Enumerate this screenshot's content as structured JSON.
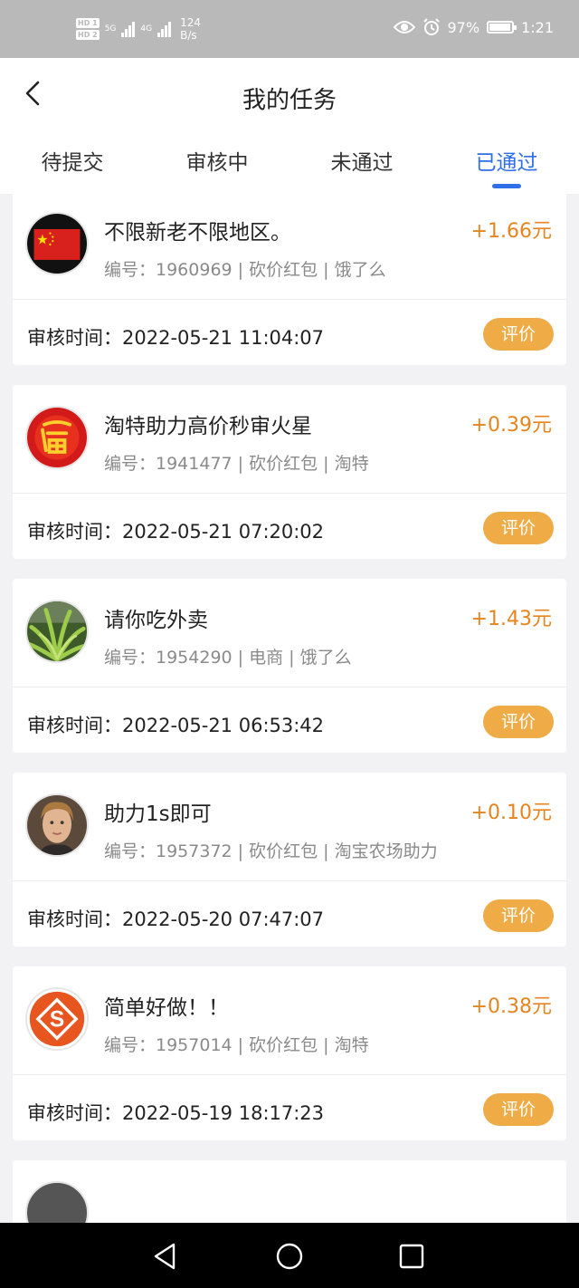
{
  "status_bar": {
    "hd1": "HD 1",
    "hd2": "HD 2",
    "network": "5G",
    "network2": "4G",
    "speed_value": "124",
    "speed_unit": "B/s",
    "battery": "97%",
    "time": "1:21"
  },
  "header": {
    "title": "我的任务",
    "tabs": [
      {
        "label": "待提交",
        "active": false
      },
      {
        "label": "审核中",
        "active": false
      },
      {
        "label": "未通过",
        "active": false
      },
      {
        "label": "已通过",
        "active": true
      }
    ]
  },
  "tasks": [
    {
      "title": "不限新老不限地区。",
      "reward": "+1.66元",
      "meta": "编号：1960969 | 砍价红包 | 饿了么",
      "time_label": "审核时间：",
      "time": "2022-05-21 11:04:07",
      "button": "评价",
      "avatar": "flag-avatar-icon"
    },
    {
      "title": "淘特助力高价秒审火星",
      "reward": "+0.39元",
      "meta": "编号：1941477 | 砍价红包 | 淘特",
      "time_label": "审核时间：",
      "time": "2022-05-21 07:20:02",
      "button": "评价",
      "avatar": "fu-avatar-icon"
    },
    {
      "title": "请你吃外卖",
      "reward": "+1.43元",
      "meta": "编号：1954290 | 电商 | 饿了么",
      "time_label": "审核时间：",
      "time": "2022-05-21 06:53:42",
      "button": "评价",
      "avatar": "plant-avatar-icon"
    },
    {
      "title": "助力1s即可",
      "reward": "+0.10元",
      "meta": "编号：1957372 | 砍价红包 | 淘宝农场助力",
      "time_label": "审核时间：",
      "time": "2022-05-20 07:47:07",
      "button": "评价",
      "avatar": "person-avatar-icon"
    },
    {
      "title": "简单好做！！",
      "reward": "+0.38元",
      "meta": "编号：1957014 | 砍价红包 | 淘特",
      "time_label": "审核时间：",
      "time": "2022-05-19 18:17:23",
      "button": "评价",
      "avatar": "s-logo-avatar-icon"
    }
  ],
  "colors": {
    "accent": "#2f6fe7",
    "reward": "#e6841e",
    "button": "#efab45"
  }
}
